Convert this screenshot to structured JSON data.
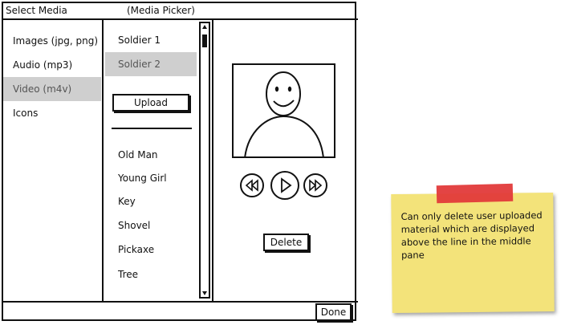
{
  "window": {
    "title": "Select Media",
    "subtitle": "(Media Picker)"
  },
  "categories": [
    {
      "label": "Images (jpg, png)",
      "selected": false
    },
    {
      "label": "Audio (mp3)",
      "selected": false
    },
    {
      "label": "Video (m4v)",
      "selected": true
    },
    {
      "label": "Icons",
      "selected": false
    }
  ],
  "user_media": [
    {
      "label": "Soldier 1",
      "selected": false
    },
    {
      "label": "Soldier 2",
      "selected": true
    }
  ],
  "upload_label": "Upload",
  "library_media": [
    {
      "label": "Old Man"
    },
    {
      "label": "Young Girl"
    },
    {
      "label": "Key"
    },
    {
      "label": "Shovel"
    },
    {
      "label": "Pickaxe"
    },
    {
      "label": "Tree"
    }
  ],
  "player": {
    "rewind_icon": "rewind-icon",
    "play_icon": "play-icon",
    "fast_forward_icon": "fast-forward-icon"
  },
  "delete_label": "Delete",
  "done_label": "Done",
  "sticky_note": {
    "text": "Can only delete user uploaded material which are displayed above the line in the middle pane"
  },
  "colors": {
    "selected_bg": "#cfcfcf",
    "sticky_bg": "#f3e37a",
    "tape": "#e23a3a"
  }
}
